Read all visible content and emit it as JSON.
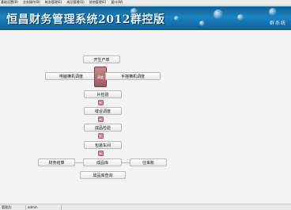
{
  "menubar": {
    "items": [
      "基础设置(B)",
      "业务操作(B)",
      "帐务管理(E)",
      "成品管理(Q)",
      "其他管理(E)",
      "窗口(W)"
    ]
  },
  "banner": {
    "title": "恒昌财务管理系统2012群控版",
    "right_text": "群系统"
  },
  "flow": {
    "open_order": "开生产单",
    "computer_dispatch": "电脑横机调度",
    "hand_dispatch": "手摇横机调度",
    "hub_label": "调度",
    "piece_check": "片检验",
    "sewing_dispatch": "缝合调度",
    "finished_check": "成品检验",
    "packing_shipping": "包装车间",
    "finance_settle": "财务结算",
    "finished_warehouse": "成品库",
    "receivables": "往来账",
    "warehouse_query": "成品库查询"
  },
  "status": {
    "left": "管理员:",
    "user": "admin"
  },
  "colors": {
    "banner_blue": "#1b84c3",
    "hub_red": "#b06f77",
    "arrow_pink": "#c98f96"
  }
}
